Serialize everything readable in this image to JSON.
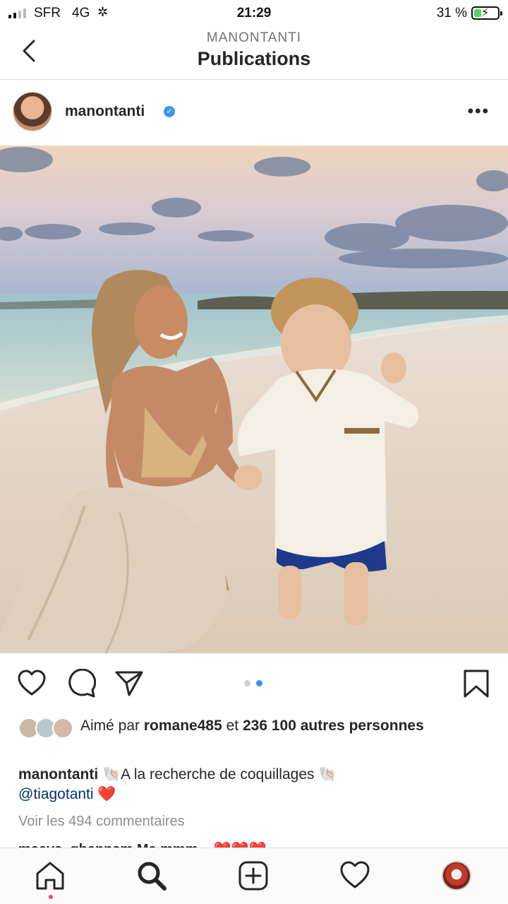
{
  "status_bar": {
    "carrier": "SFR",
    "network": "4G",
    "activity_glyph": "✲",
    "time": "21:29",
    "battery_percent_text": "31 %",
    "battery_level": 0.31,
    "signal_bars": 2
  },
  "header": {
    "account": "MANONTANTI",
    "title": "Publications",
    "back_icon": "chevron-left-icon"
  },
  "post": {
    "username": "manontanti",
    "verified_glyph": "✓",
    "more_glyph": "•••",
    "carousel": {
      "count": 2,
      "active_index": 1
    },
    "likes": {
      "prefix": "Aimé par ",
      "user": "romane485",
      "middle": " et ",
      "count_text": "236 100 autres personnes"
    },
    "caption": {
      "username": "manontanti",
      "text": " 🐚A la recherche de coquillages 🐚",
      "mention": "@tiagotanti",
      "emoji": " ❤️"
    },
    "view_comments": "Voir les 494 commentaires",
    "peek_comment": "maeva_ghennam Ma mmm... ❤️❤️❤️"
  },
  "tabs": [
    "home-icon",
    "search-icon",
    "add-post-icon",
    "activity-heart-icon",
    "profile-avatar"
  ],
  "colors": {
    "accent_blue": "#3897f0",
    "mention_blue": "#003569",
    "notification_red": "#ed4956",
    "battery_green": "#4cd964"
  }
}
